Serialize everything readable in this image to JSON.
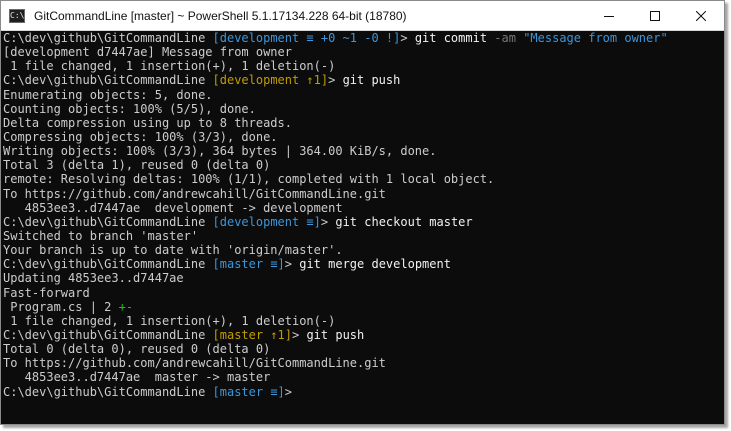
{
  "window": {
    "title": "GitCommandLine [master] ~ PowerShell 5.1.17134.228 64-bit (18780)",
    "icon_text": "C:\\",
    "icons": {
      "app": "powershell-app-icon",
      "minimize": "minimize-icon",
      "maximize": "maximize-icon",
      "close": "close-icon"
    }
  },
  "colors": {
    "background": "#0c0c0c",
    "text": "#cccccc",
    "command": "#f2f2f2",
    "branch": "#3a96dd",
    "branch_ahead": "#c19c00",
    "dim": "#767676",
    "added": "#16c60c",
    "removed": "#e74856"
  },
  "terminal": {
    "lines": [
      [
        [
          "C:\\dev\\github\\GitCommandLine ",
          "default"
        ],
        [
          "[development ≡ +0 ~1 -0 !]",
          "branch"
        ],
        [
          "> ",
          "default"
        ],
        [
          "git commit ",
          "cmd"
        ],
        [
          "-am ",
          "flag"
        ],
        [
          "\"Message from owner\"",
          "string"
        ]
      ],
      [
        [
          "[development d7447ae] Message from owner",
          "default"
        ]
      ],
      [
        [
          " 1 file changed, 1 insertion(+), 1 deletion(-)",
          "default"
        ]
      ],
      [
        [
          "C:\\dev\\github\\GitCommandLine ",
          "default"
        ],
        [
          "[development ↑1]",
          "branch-ahead"
        ],
        [
          "> ",
          "default"
        ],
        [
          "git push",
          "cmd"
        ]
      ],
      [
        [
          "Enumerating objects: 5, done.",
          "default"
        ]
      ],
      [
        [
          "Counting objects: 100% (5/5), done.",
          "default"
        ]
      ],
      [
        [
          "Delta compression using up to 8 threads.",
          "default"
        ]
      ],
      [
        [
          "Compressing objects: 100% (3/3), done.",
          "default"
        ]
      ],
      [
        [
          "Writing objects: 100% (3/3), 364 bytes | 364.00 KiB/s, done.",
          "default"
        ]
      ],
      [
        [
          "Total 3 (delta 1), reused 0 (delta 0)",
          "default"
        ]
      ],
      [
        [
          "remote: Resolving deltas: 100% (1/1), completed with 1 local object.",
          "default"
        ]
      ],
      [
        [
          "To https://github.com/andrewcahill/GitCommandLine.git",
          "default"
        ]
      ],
      [
        [
          "   4853ee3..d7447ae  development -> development",
          "default"
        ]
      ],
      [
        [
          "C:\\dev\\github\\GitCommandLine ",
          "default"
        ],
        [
          "[development ≡]",
          "branch"
        ],
        [
          "> ",
          "default"
        ],
        [
          "git checkout master",
          "cmd"
        ]
      ],
      [
        [
          "Switched to branch 'master'",
          "default"
        ]
      ],
      [
        [
          "Your branch is up to date with 'origin/master'.",
          "default"
        ]
      ],
      [
        [
          "C:\\dev\\github\\GitCommandLine ",
          "default"
        ],
        [
          "[master ≡]",
          "branch"
        ],
        [
          "> ",
          "default"
        ],
        [
          "git merge development",
          "cmd"
        ]
      ],
      [
        [
          "Updating 4853ee3..d7447ae",
          "default"
        ]
      ],
      [
        [
          "Fast-forward",
          "default"
        ]
      ],
      [
        [
          " Program.cs | 2 ",
          "default"
        ],
        [
          "+",
          "plus"
        ],
        [
          "-",
          "minus"
        ]
      ],
      [
        [
          " 1 file changed, 1 insertion(+), 1 deletion(-)",
          "default"
        ]
      ],
      [
        [
          "C:\\dev\\github\\GitCommandLine ",
          "default"
        ],
        [
          "[master ↑1]",
          "branch-ahead"
        ],
        [
          "> ",
          "default"
        ],
        [
          "git push",
          "cmd"
        ]
      ],
      [
        [
          "Total 0 (delta 0), reused 0 (delta 0)",
          "default"
        ]
      ],
      [
        [
          "To https://github.com/andrewcahill/GitCommandLine.git",
          "default"
        ]
      ],
      [
        [
          "   4853ee3..d7447ae  master -> master",
          "default"
        ]
      ],
      [
        [
          "C:\\dev\\github\\GitCommandLine ",
          "default"
        ],
        [
          "[master ≡]",
          "branch"
        ],
        [
          "> ",
          "default"
        ]
      ]
    ]
  }
}
